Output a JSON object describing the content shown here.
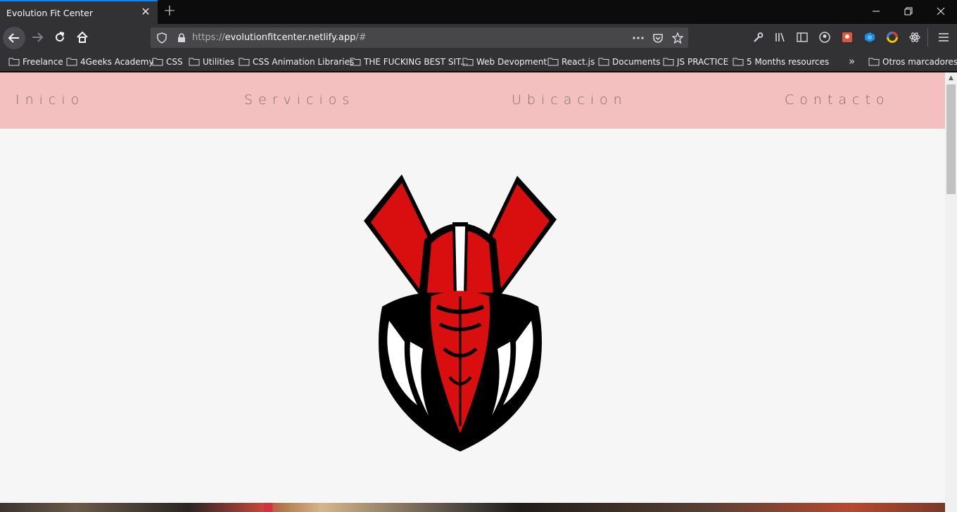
{
  "browser": {
    "tab": {
      "title": "Evolution Fit Center",
      "close": "✕"
    },
    "new_tab": "+",
    "url": {
      "scheme": "https://",
      "host": "evolutionfitcenter.netlify.app",
      "path": "/#"
    },
    "bookmarks": [
      "Freelance",
      "4Geeks Academy",
      "CSS",
      "Utilities",
      "CSS Animation Libraries",
      "THE FUCKING BEST SIT...",
      "Web Devopment",
      "React.js",
      "Documents",
      "JS PRACTICE",
      "5 Months resources"
    ],
    "overflow_chevron": "»",
    "other_bookmarks": "Otros marcadores"
  },
  "site": {
    "nav": [
      "Inicio",
      "Servicios",
      "Ubicacion",
      "Contacto"
    ],
    "colors": {
      "nav_bg": "#f4c0bf",
      "logo_red": "#d90e0e",
      "page_bg": "#f6f6f6"
    }
  }
}
